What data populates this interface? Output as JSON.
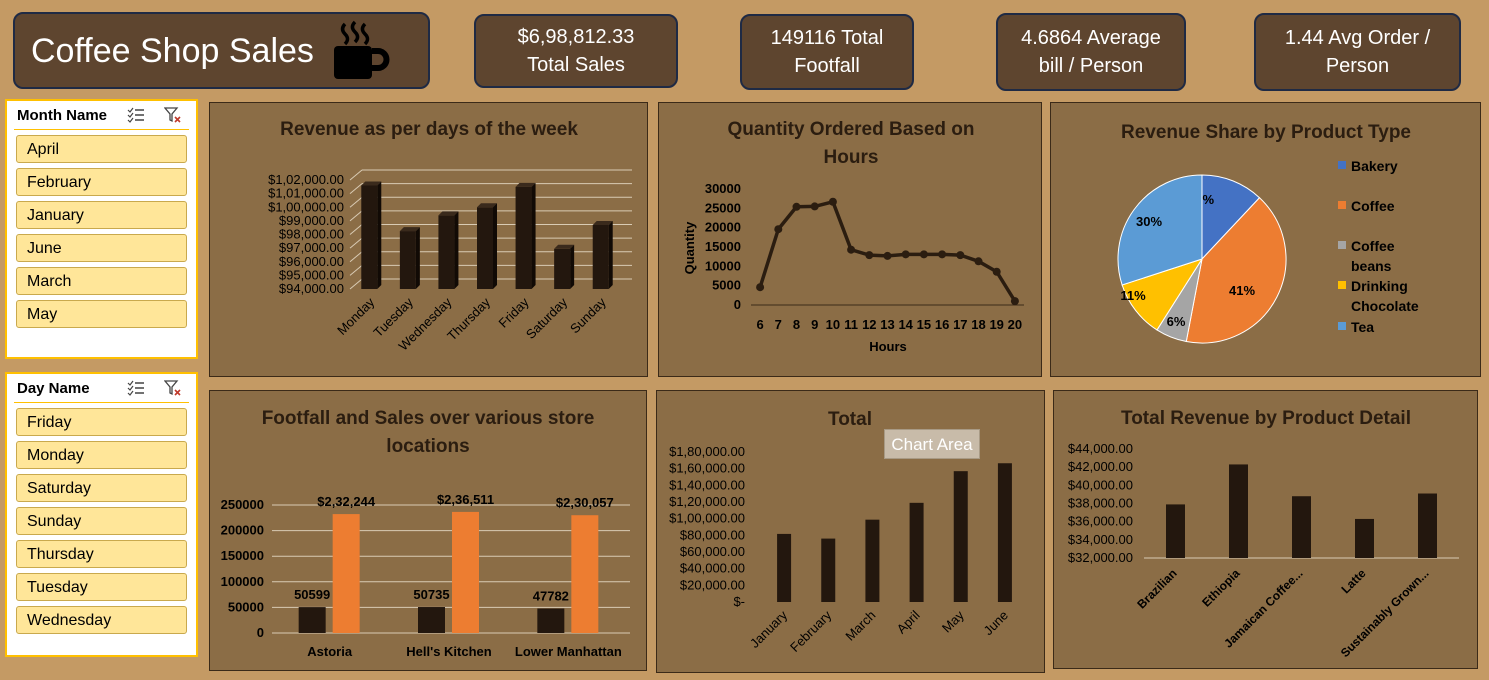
{
  "header": {
    "title": "Coffee Shop Sales",
    "kpis": [
      {
        "line1": "$6,98,812.33",
        "line2": "Total Sales"
      },
      {
        "line1": "149116  Total",
        "line2": "Footfall"
      },
      {
        "line1": "4.6864 Average",
        "line2": "bill / Person"
      },
      {
        "line1": "1.44 Avg Order /",
        "line2": "Person"
      }
    ]
  },
  "slicers": {
    "month": {
      "title": "Month Name",
      "items": [
        "April",
        "February",
        "January",
        "June",
        "March",
        "May"
      ]
    },
    "day": {
      "title": "Day Name",
      "items": [
        "Friday",
        "Monday",
        "Saturday",
        "Sunday",
        "Thursday",
        "Tuesday",
        "Wednesday"
      ]
    }
  },
  "tooltip": "Chart Area",
  "colors": {
    "bar": "#23170e",
    "orange": "#ed7d31",
    "panel": "#8b6d46",
    "bg": "#c49a64"
  },
  "chart_data": [
    {
      "id": "weekday",
      "type": "bar",
      "title": "Revenue as per days of the week",
      "categories": [
        "Monday",
        "Tuesday",
        "Wednesday",
        "Thursday",
        "Friday",
        "Saturday",
        "Sunday"
      ],
      "values": [
        101600,
        98250,
        99400,
        100000,
        101500,
        96950,
        98700
      ],
      "ylim": [
        94000,
        102000
      ],
      "yticks": [
        "$1,02,000.00",
        "$1,01,000.00",
        "$1,00,000.00",
        "$99,000.00",
        "$98,000.00",
        "$97,000.00",
        "$96,000.00",
        "$95,000.00",
        "$94,000.00"
      ]
    },
    {
      "id": "hours",
      "type": "line",
      "title": "Quantity Ordered Based on Hours",
      "xlabel": "Hours",
      "ylabel": "Quantity",
      "x": [
        6,
        7,
        8,
        9,
        10,
        11,
        12,
        13,
        14,
        15,
        16,
        17,
        18,
        19,
        20
      ],
      "values": [
        4600,
        19600,
        25400,
        25500,
        26700,
        14300,
        12900,
        12700,
        13100,
        13100,
        13100,
        12900,
        11300,
        8600,
        1000
      ],
      "ylim": [
        0,
        30000
      ],
      "yticks": [
        "30000",
        "25000",
        "20000",
        "15000",
        "10000",
        "5000",
        "0"
      ]
    },
    {
      "id": "share",
      "type": "pie",
      "title": "Revenue Share by Product Type",
      "labels": [
        "Bakery",
        "Coffee",
        "Coffee beans",
        "Drinking Chocolate",
        "Tea"
      ],
      "values": [
        12,
        41,
        6,
        11,
        30
      ],
      "display": [
        "12%",
        "41%",
        "6%",
        "11%",
        "30%"
      ],
      "colors": [
        "#4472c4",
        "#ed7d31",
        "#a5a5a5",
        "#ffc000",
        "#5b9bd5"
      ]
    },
    {
      "id": "stores",
      "type": "bar",
      "title": "Footfall and Sales over various store locations",
      "categories": [
        "Astoria",
        "Hell's Kitchen",
        "Lower Manhattan"
      ],
      "series": [
        {
          "values": [
            50599,
            50735,
            47782
          ],
          "labels": [
            "50599",
            "50735",
            "47782"
          ]
        },
        {
          "values": [
            232244,
            236511,
            230057
          ],
          "labels": [
            "$2,32,244",
            "$2,36,511",
            "$2,30,057"
          ]
        }
      ],
      "ylim": [
        0,
        250000
      ],
      "yticks": [
        "250000",
        "200000",
        "150000",
        "100000",
        "50000",
        "0"
      ]
    },
    {
      "id": "monthly",
      "type": "bar",
      "title": "Total",
      "categories": [
        "January",
        "February",
        "March",
        "April",
        "May",
        "June"
      ],
      "values": [
        81700,
        76100,
        98800,
        119000,
        157000,
        166500
      ],
      "ylim": [
        0,
        180000
      ],
      "yticks": [
        "$1,80,000.00",
        "$1,60,000.00",
        "$1,40,000.00",
        "$1,20,000.00",
        "$1,00,000.00",
        "$80,000.00",
        "$60,000.00",
        "$40,000.00",
        "$20,000.00",
        "$-"
      ]
    },
    {
      "id": "detail",
      "type": "bar",
      "title": "Total Revenue by Product Detail",
      "categories": [
        "Brazilian",
        "Ethiopia",
        "Jamaican Coffee...",
        "Latte",
        "Sustainably Grown..."
      ],
      "values": [
        37900,
        42300,
        38800,
        36300,
        39100
      ],
      "ylim": [
        32000,
        44000
      ],
      "yticks": [
        "$44,000.00",
        "$42,000.00",
        "$40,000.00",
        "$38,000.00",
        "$36,000.00",
        "$34,000.00",
        "$32,000.00"
      ]
    }
  ]
}
